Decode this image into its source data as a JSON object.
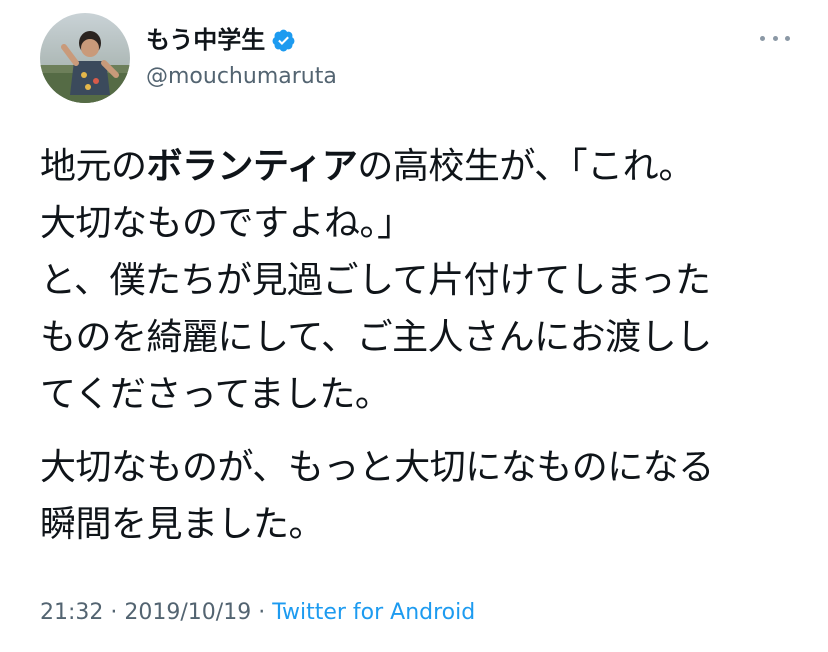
{
  "author": {
    "display_name": "もう中学生",
    "handle": "@mouchumaruta",
    "verified": true
  },
  "icons": {
    "avatar": "profile-photo",
    "verified": "verified-badge-icon",
    "more": "more-options-icon"
  },
  "tweet": {
    "p1_l1_a": "地元の",
    "p1_l1_bold": "ボランティア",
    "p1_l1_b": "の高校生が、「これ。",
    "p1_l2": "大切なものですよね。」",
    "p1_l3": "と、僕たちが見過ごして片付けてしまった",
    "p1_l4": "ものを綺麗にして、ご主人さんにお渡しし",
    "p1_l5": "てくださってました。",
    "p2_l1": "大切なものが、もっと大切になものになる",
    "p2_l2": "瞬間を見ました。"
  },
  "meta": {
    "time": "21:32",
    "sep1": " · ",
    "date": "2019/10/19",
    "sep2": " · ",
    "source": "Twitter for Android"
  },
  "colors": {
    "text": "#0f1419",
    "secondary": "#536471",
    "link": "#1d9bf0",
    "verified": "#1d9bf0"
  }
}
